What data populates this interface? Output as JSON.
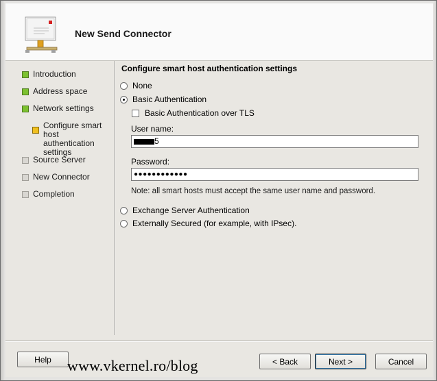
{
  "window": {
    "title": "New Send Connector"
  },
  "nav": {
    "items": [
      {
        "label": "Introduction",
        "state": "complete"
      },
      {
        "label": "Address space",
        "state": "complete"
      },
      {
        "label": "Network settings",
        "state": "complete"
      },
      {
        "label": "Configure smart host authentication settings",
        "state": "current"
      },
      {
        "label": "Source Server",
        "state": "pending"
      },
      {
        "label": "New Connector",
        "state": "pending"
      },
      {
        "label": "Completion",
        "state": "pending"
      }
    ]
  },
  "content": {
    "title": "Configure smart host authentication settings",
    "options": {
      "none": "None",
      "basic": "Basic Authentication",
      "basic_tls": "Basic Authentication over TLS",
      "exchange": "Exchange Server Authentication",
      "external": "Externally Secured (for example, with IPsec)."
    },
    "selected": "basic",
    "username_label": "User name:",
    "username_value_suffix": "5",
    "password_label": "Password:",
    "password_value": "●●●●●●●●●●●●",
    "note": "Note: all smart hosts must accept the same user name and password."
  },
  "footer": {
    "help": "Help",
    "back": "< Back",
    "next": "Next >",
    "cancel": "Cancel",
    "watermark": "www.vkernel.ro/blog"
  },
  "colors": {
    "complete": "#7cc130",
    "current": "#f0c020",
    "pending": "#d9d7d2"
  }
}
